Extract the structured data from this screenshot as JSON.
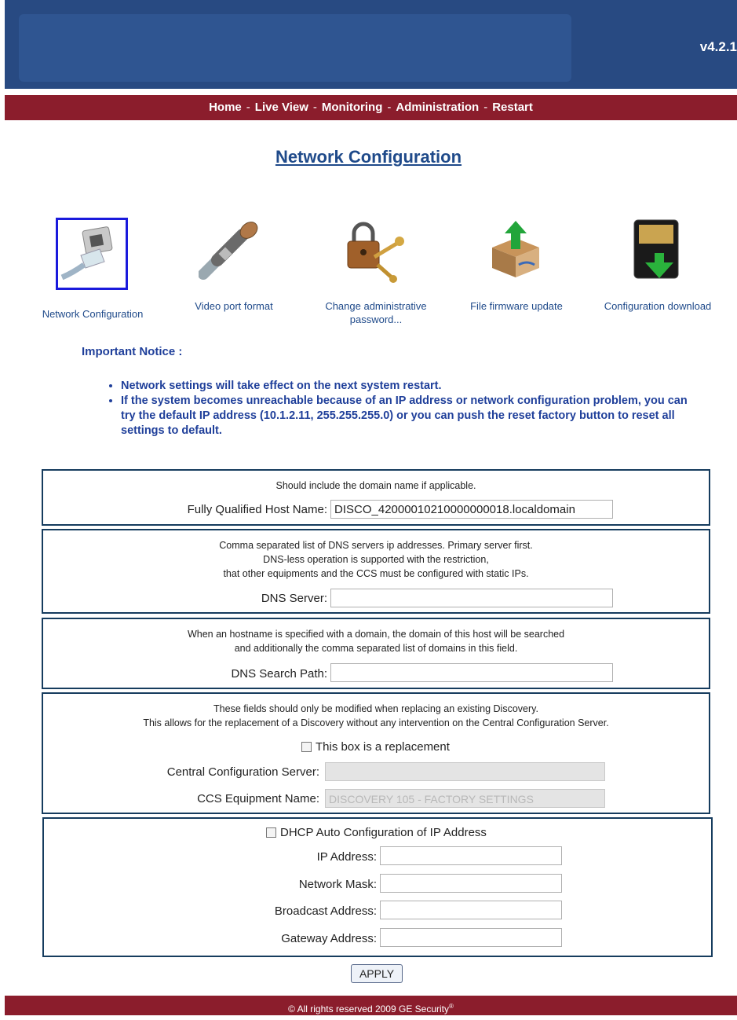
{
  "header": {
    "version": "v4.2.1"
  },
  "nav": {
    "items": [
      "Home",
      "Live View",
      "Monitoring",
      "Administration",
      "Restart"
    ],
    "separator": "-"
  },
  "page_title": "Network Configuration",
  "icons": [
    {
      "label": "Network Configuration",
      "icon": "network-cable-icon",
      "selected": true
    },
    {
      "label": "Video port format",
      "icon": "bnc-connector-icon"
    },
    {
      "label": "Change administrative password...",
      "icon": "padlock-keys-icon"
    },
    {
      "label": "File firmware update",
      "icon": "box-upload-icon"
    },
    {
      "label": "Configuration download",
      "icon": "memory-card-download-icon"
    }
  ],
  "notice": {
    "title": "Important Notice :",
    "items": [
      "Network settings will take effect on the next system restart.",
      "If the system becomes unreachable because of an IP address or network configuration problem, you can try the default IP address (10.1.2.11, 255.255.255.0) or you can push the reset factory button to reset all settings to default."
    ]
  },
  "hostname": {
    "hint": "Should include the domain name if applicable.",
    "label": "Fully Qualified Host Name:",
    "value": "DISCO_42000010210000000018.localdomain"
  },
  "dns": {
    "hint_lines": [
      "Comma separated list of DNS servers ip addresses. Primary server first.",
      "DNS-less operation is supported with the restriction,",
      "that other equipments and the CCS must be configured with static IPs."
    ],
    "label": "DNS Server:",
    "value": ""
  },
  "search_path": {
    "hint_lines": [
      "When an hostname is specified with a domain, the domain of this host will be searched",
      "and additionally the comma separated list of domains in this field."
    ],
    "label": "DNS Search Path:",
    "value": ""
  },
  "replacement": {
    "hint_lines": [
      "These fields should only be modified when replacing an existing Discovery.",
      "This allows for the replacement of a Discovery without any intervention on the Central Configuration Server."
    ],
    "checkbox_label": "This box is a replacement",
    "checked": false,
    "ccs_label": "Central Configuration Server:",
    "ccs_value": "",
    "equipment_label": "CCS Equipment Name:",
    "equipment_placeholder": "DISCOVERY 105 - FACTORY SETTINGS"
  },
  "ip": {
    "dhcp_label": "DHCP Auto Configuration of IP Address",
    "dhcp_checked": false,
    "ip_label": "IP Address:",
    "mask_label": "Network Mask:",
    "broadcast_label": "Broadcast Address:",
    "gateway_label": "Gateway Address:"
  },
  "apply_label": "APPLY",
  "footer": {
    "text": "© All rights reserved 2009  GE Security",
    "mark": "®"
  },
  "colors": {
    "header": "#284a82",
    "nav": "#8b1d2c",
    "link": "#1f4a8a",
    "notice": "#1f3f9a",
    "panel_border": "#163c5e"
  }
}
